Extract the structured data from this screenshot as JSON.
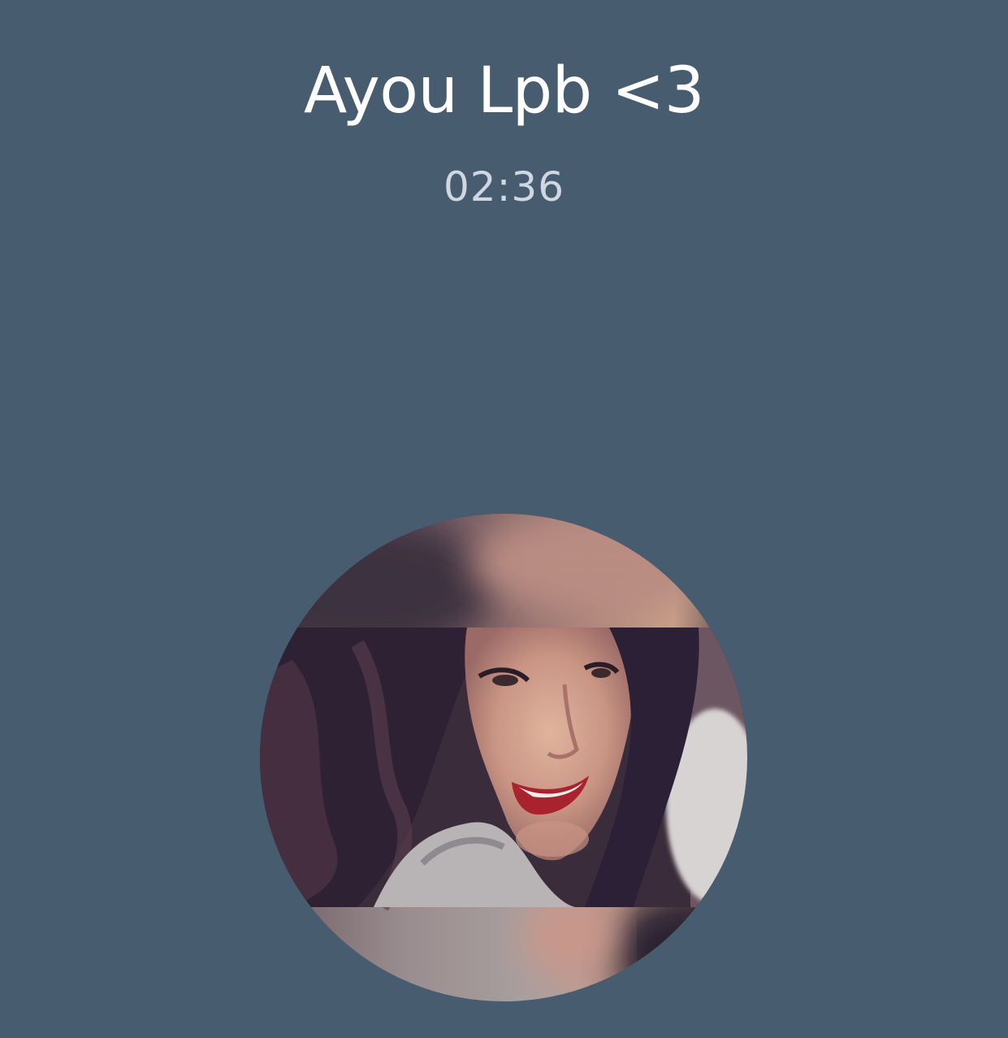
{
  "call": {
    "caller_name": "Ayou Lpb <3",
    "duration": "02:36"
  },
  "avatar": {
    "description_icon": "contact-photo"
  },
  "colors": {
    "background": "#485c6f",
    "name_text": "#ffffff",
    "timer_text": "#cfd8e1"
  }
}
